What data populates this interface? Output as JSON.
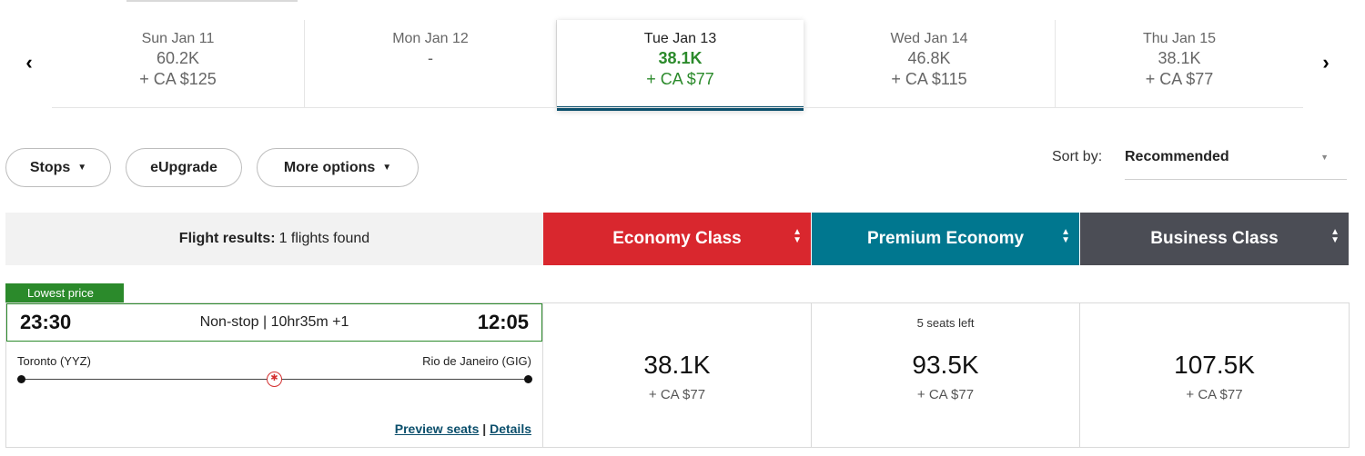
{
  "dates": [
    {
      "day": "Sun Jan 11",
      "points": "60.2K",
      "tax": "+ CA $125"
    },
    {
      "day": "Mon Jan 12",
      "points": "-",
      "tax": ""
    },
    {
      "day": "Tue Jan 13",
      "points": "38.1K",
      "tax": "+ CA $77"
    },
    {
      "day": "Wed Jan 14",
      "points": "46.8K",
      "tax": "+ CA $115"
    },
    {
      "day": "Thu Jan 15",
      "points": "38.1K",
      "tax": "+ CA $77"
    }
  ],
  "filters": {
    "stops": "Stops",
    "eupgrade": "eUpgrade",
    "more": "More options"
  },
  "sort": {
    "label": "Sort by:",
    "value": "Recommended"
  },
  "results": {
    "label": "Flight results:",
    "count": "1 flights found"
  },
  "cabins": {
    "economy": "Economy Class",
    "premium": "Premium Economy",
    "business": "Business Class"
  },
  "colors": {
    "economy": "#d9272e",
    "premium": "#00778f",
    "business": "#4b4d55",
    "accent": "#2b8a2b"
  },
  "flight": {
    "badge": "Lowest price",
    "depart": "23:30",
    "summary": "Non-stop | 10hr35m +1",
    "arrive": "12:05",
    "origin": "Toronto (YYZ)",
    "destination": "Rio de Janeiro (GIG)",
    "preview": "Preview seats",
    "separator": "|",
    "details": "Details"
  },
  "fares": {
    "economy": {
      "seats": "",
      "points": "38.1K",
      "tax": "+ CA $77"
    },
    "premium": {
      "seats": "5 seats left",
      "points": "93.5K",
      "tax": "+ CA $77"
    },
    "business": {
      "seats": "",
      "points": "107.5K",
      "tax": "+ CA $77"
    }
  }
}
